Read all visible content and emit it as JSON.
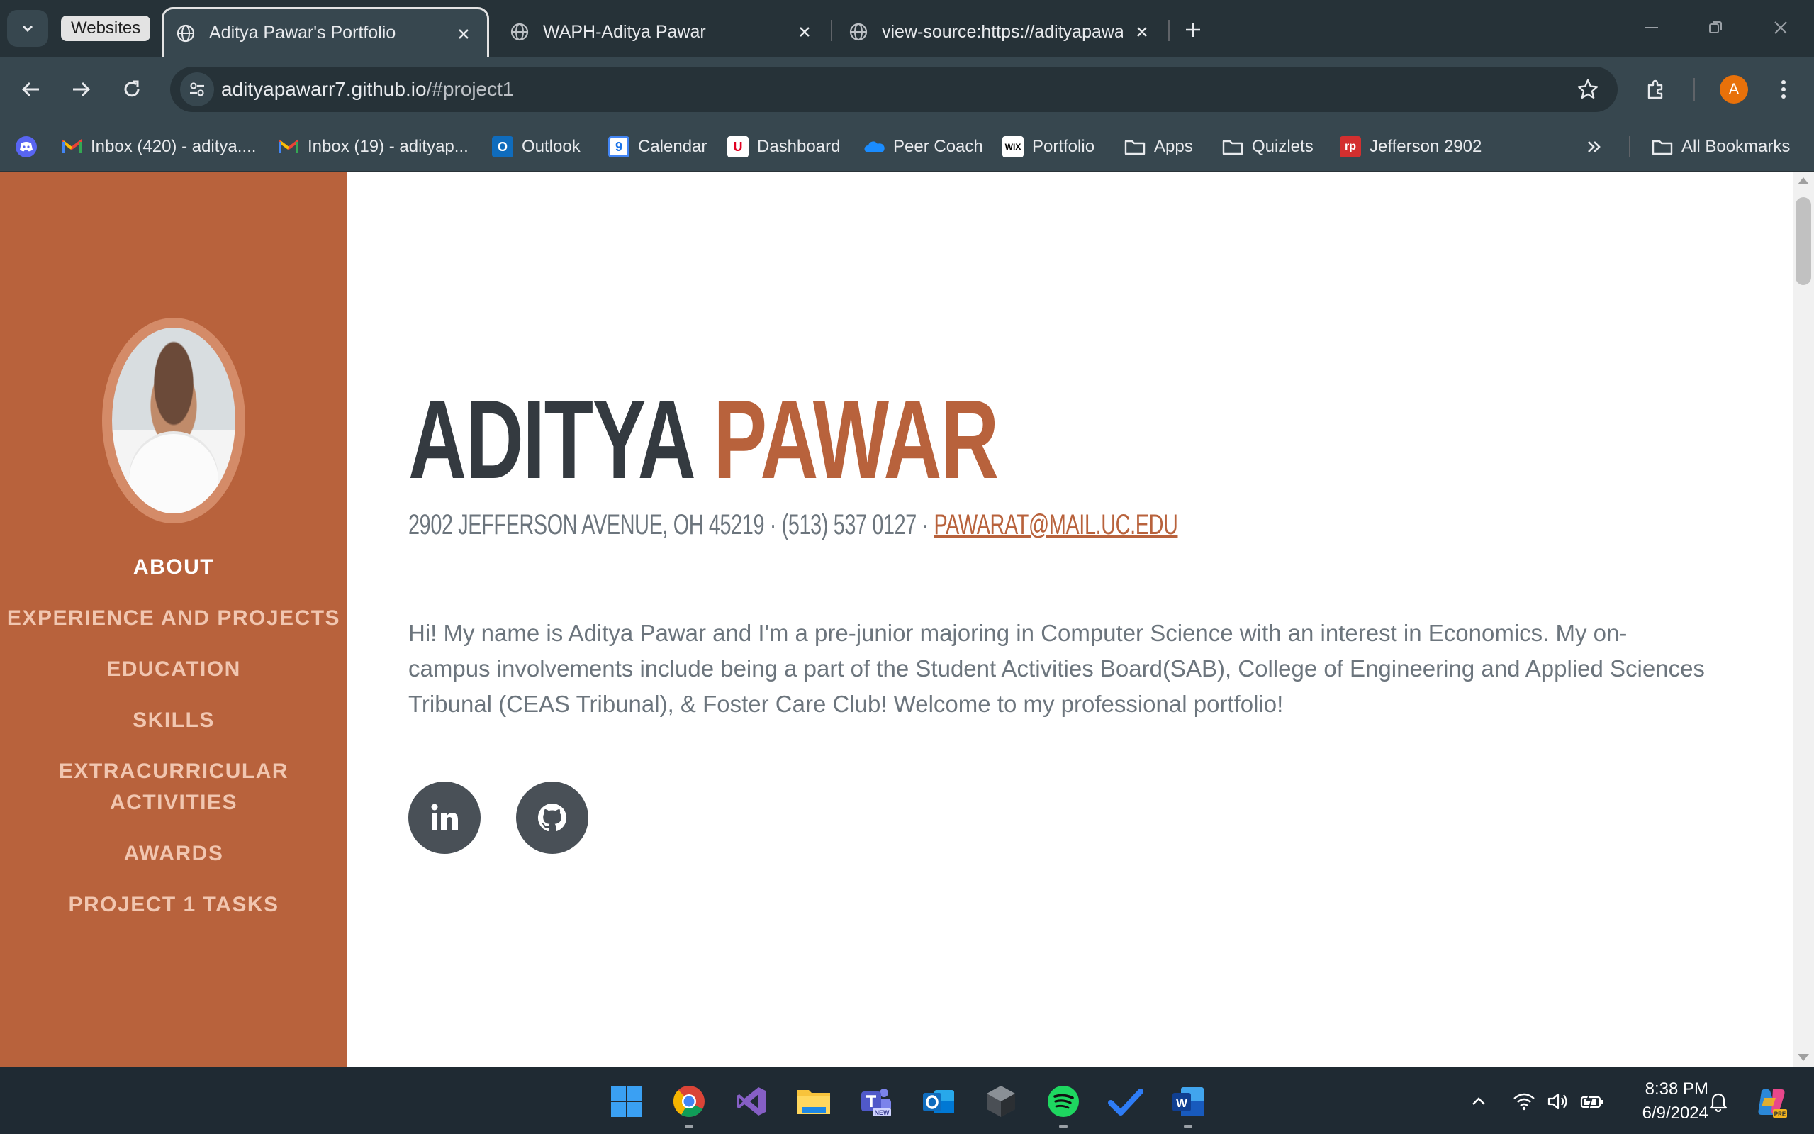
{
  "browser": {
    "tab_group_label": "Websites",
    "tabs": [
      {
        "title": "Aditya Pawar's Portfolio",
        "active": true
      },
      {
        "title": "WAPH-Aditya Pawar",
        "active": false
      },
      {
        "title": "view-source:https://adityapawar",
        "active": false
      }
    ],
    "url_host": "adityapawarr7.github.io",
    "url_path": "/#project1",
    "profile_initial": "A",
    "bookmarks": [
      {
        "label": "",
        "icon": "discord-icon"
      },
      {
        "label": "Inbox (420) - aditya....",
        "icon": "gmail-icon"
      },
      {
        "label": "Inbox (19) - adityap...",
        "icon": "gmail-icon"
      },
      {
        "label": "Outlook",
        "icon": "outlook-icon"
      },
      {
        "label": "Calendar",
        "icon": "calendar-icon"
      },
      {
        "label": "Dashboard",
        "icon": "uc-icon"
      },
      {
        "label": "Peer Coach",
        "icon": "onedrive-icon"
      },
      {
        "label": "Portfolio",
        "icon": "wix-icon"
      },
      {
        "label": "Apps",
        "icon": "folder-icon"
      },
      {
        "label": "Quizlets",
        "icon": "folder-icon"
      },
      {
        "label": "Jefferson 2902",
        "icon": "rp-icon"
      }
    ],
    "all_bookmarks_label": "All Bookmarks"
  },
  "sidebar": {
    "nav": [
      {
        "label": "About",
        "active": true
      },
      {
        "label": "Experience and Projects",
        "active": false
      },
      {
        "label": "Education",
        "active": false
      },
      {
        "label": "Skills",
        "active": false
      },
      {
        "label": "Extracurricular Activities",
        "active": false
      },
      {
        "label": "Awards",
        "active": false
      },
      {
        "label": "Project 1 Tasks",
        "active": false
      }
    ]
  },
  "about": {
    "first_name": "ADITYA",
    "last_name": "PAWAR",
    "contact_text": "2902 Jefferson Avenue, OH 45219 · (513) 537 0127 · ",
    "email": "pawarat@mail.uc.edu",
    "bio": "Hi! My name is Aditya Pawar and I'm a pre-junior majoring in Computer Science with an interest in Economics. My on-campus involvements include being a part of the Student Activities Board(SAB), College of Engineering and Applied Sciences Tribunal (CEAS Tribunal), & Foster Care Club! Welcome to my professional portfolio!",
    "social": [
      {
        "name": "linkedin"
      },
      {
        "name": "github"
      }
    ]
  },
  "taskbar": {
    "time": "8:38 PM",
    "date": "6/9/2024"
  },
  "colors": {
    "accent": "#b8623c",
    "dark_text": "#343a40",
    "muted_text": "#6c757d"
  }
}
